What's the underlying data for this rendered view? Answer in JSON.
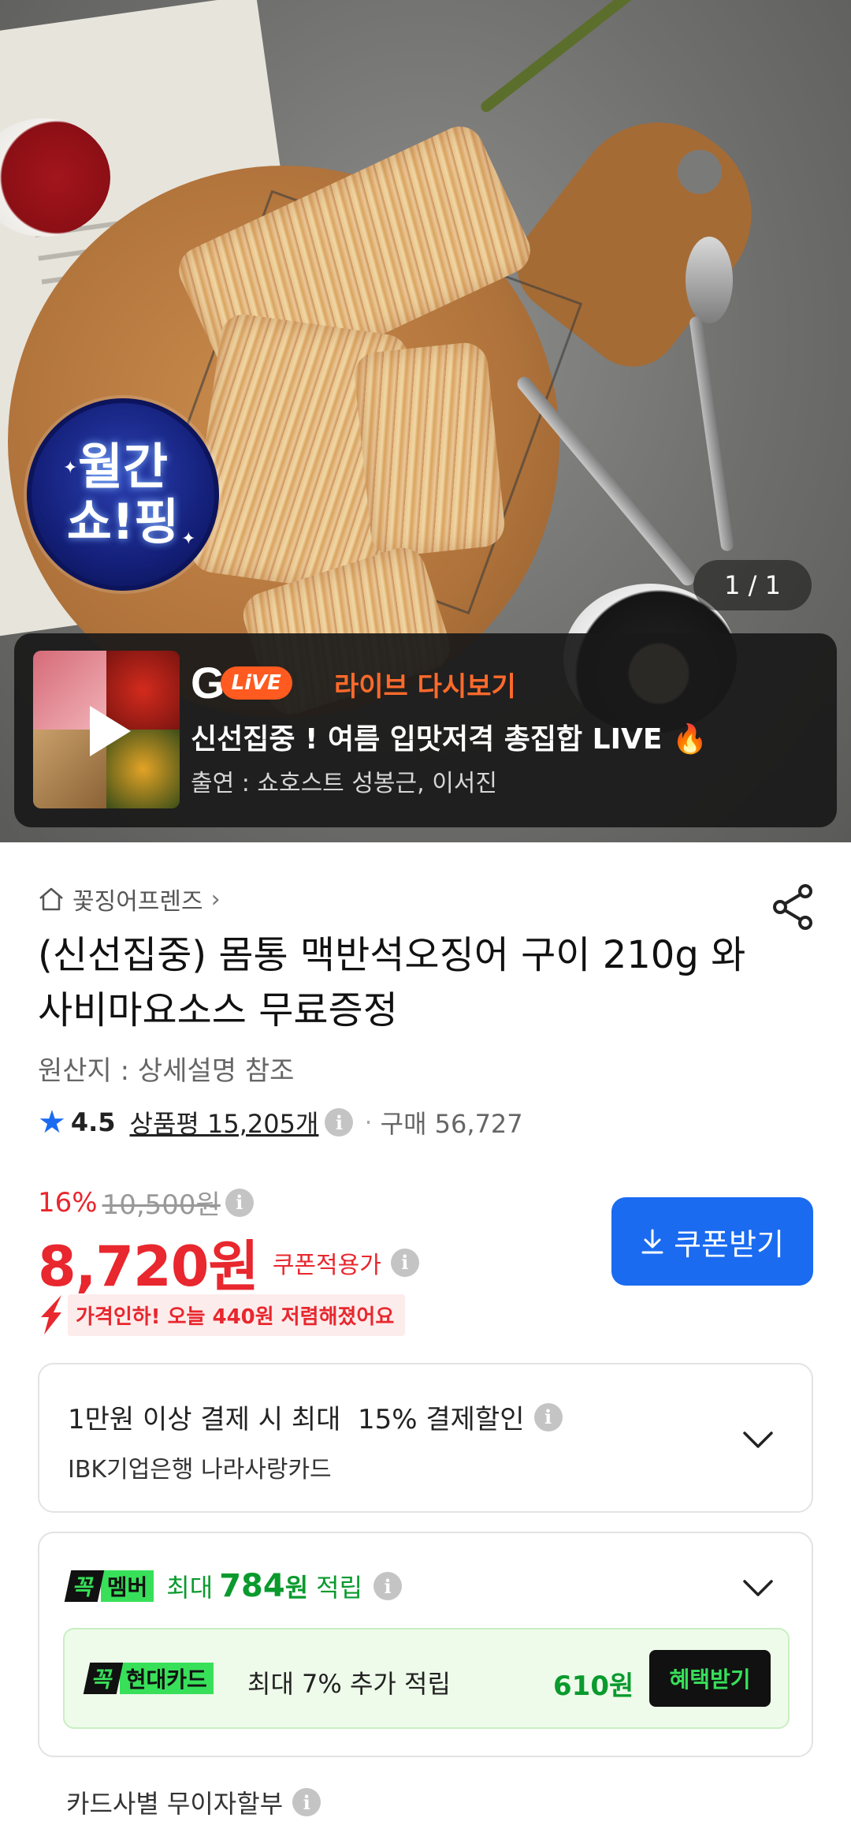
{
  "hero": {
    "badge_line1": "월간",
    "badge_line2": "쇼!핑",
    "page_indicator": "1 / 1",
    "live": {
      "logo_g": "G",
      "logo_live": "LiVE",
      "replay_label": "라이브 다시보기",
      "title": "신선집중 ! 여름 입맛저격 총집합 LIVE 🔥",
      "cast": "출연 : 쇼호스트 성봉근, 이서진"
    }
  },
  "product": {
    "breadcrumb": "꽃징어프렌즈",
    "title": "(신선집중) 몸통 맥반석오징어 구이 210g 와사비마요소스 무료증정",
    "origin": "원산지 : 상세설명 참조",
    "rating": "4.5",
    "review_label": "상품평 15,205개",
    "purchase_label": "구매 56,727",
    "discount_pct": "16%",
    "original_price": "10,500원",
    "price": "8,720원",
    "price_label": "쿠폰적용가",
    "coupon_button": "쿠폰받기",
    "price_drop": "가격인하! 오늘 440원 저렴해졌어요"
  },
  "payment_discount": {
    "line1": "1만원 이상 결제 시 최대  15% 결제할인",
    "line2": "IBK기업은행 나라사랑카드"
  },
  "membership": {
    "tag_k": "꼭",
    "tag_member": "멤버",
    "max_label": "최대",
    "amount": "784",
    "unit": "원",
    "accrue_label": "적립",
    "card_tag": "현대카드",
    "card_desc": "최대 7% 추가 적립",
    "card_won": "610원",
    "benefit_button": "혜택받기"
  },
  "installment": {
    "label": "카드사별 무이자할부"
  },
  "colors": {
    "accent_blue": "#1a6bf0",
    "price_red": "#e8272e",
    "member_green": "#38e05a",
    "live_orange": "#ff6a2b"
  }
}
